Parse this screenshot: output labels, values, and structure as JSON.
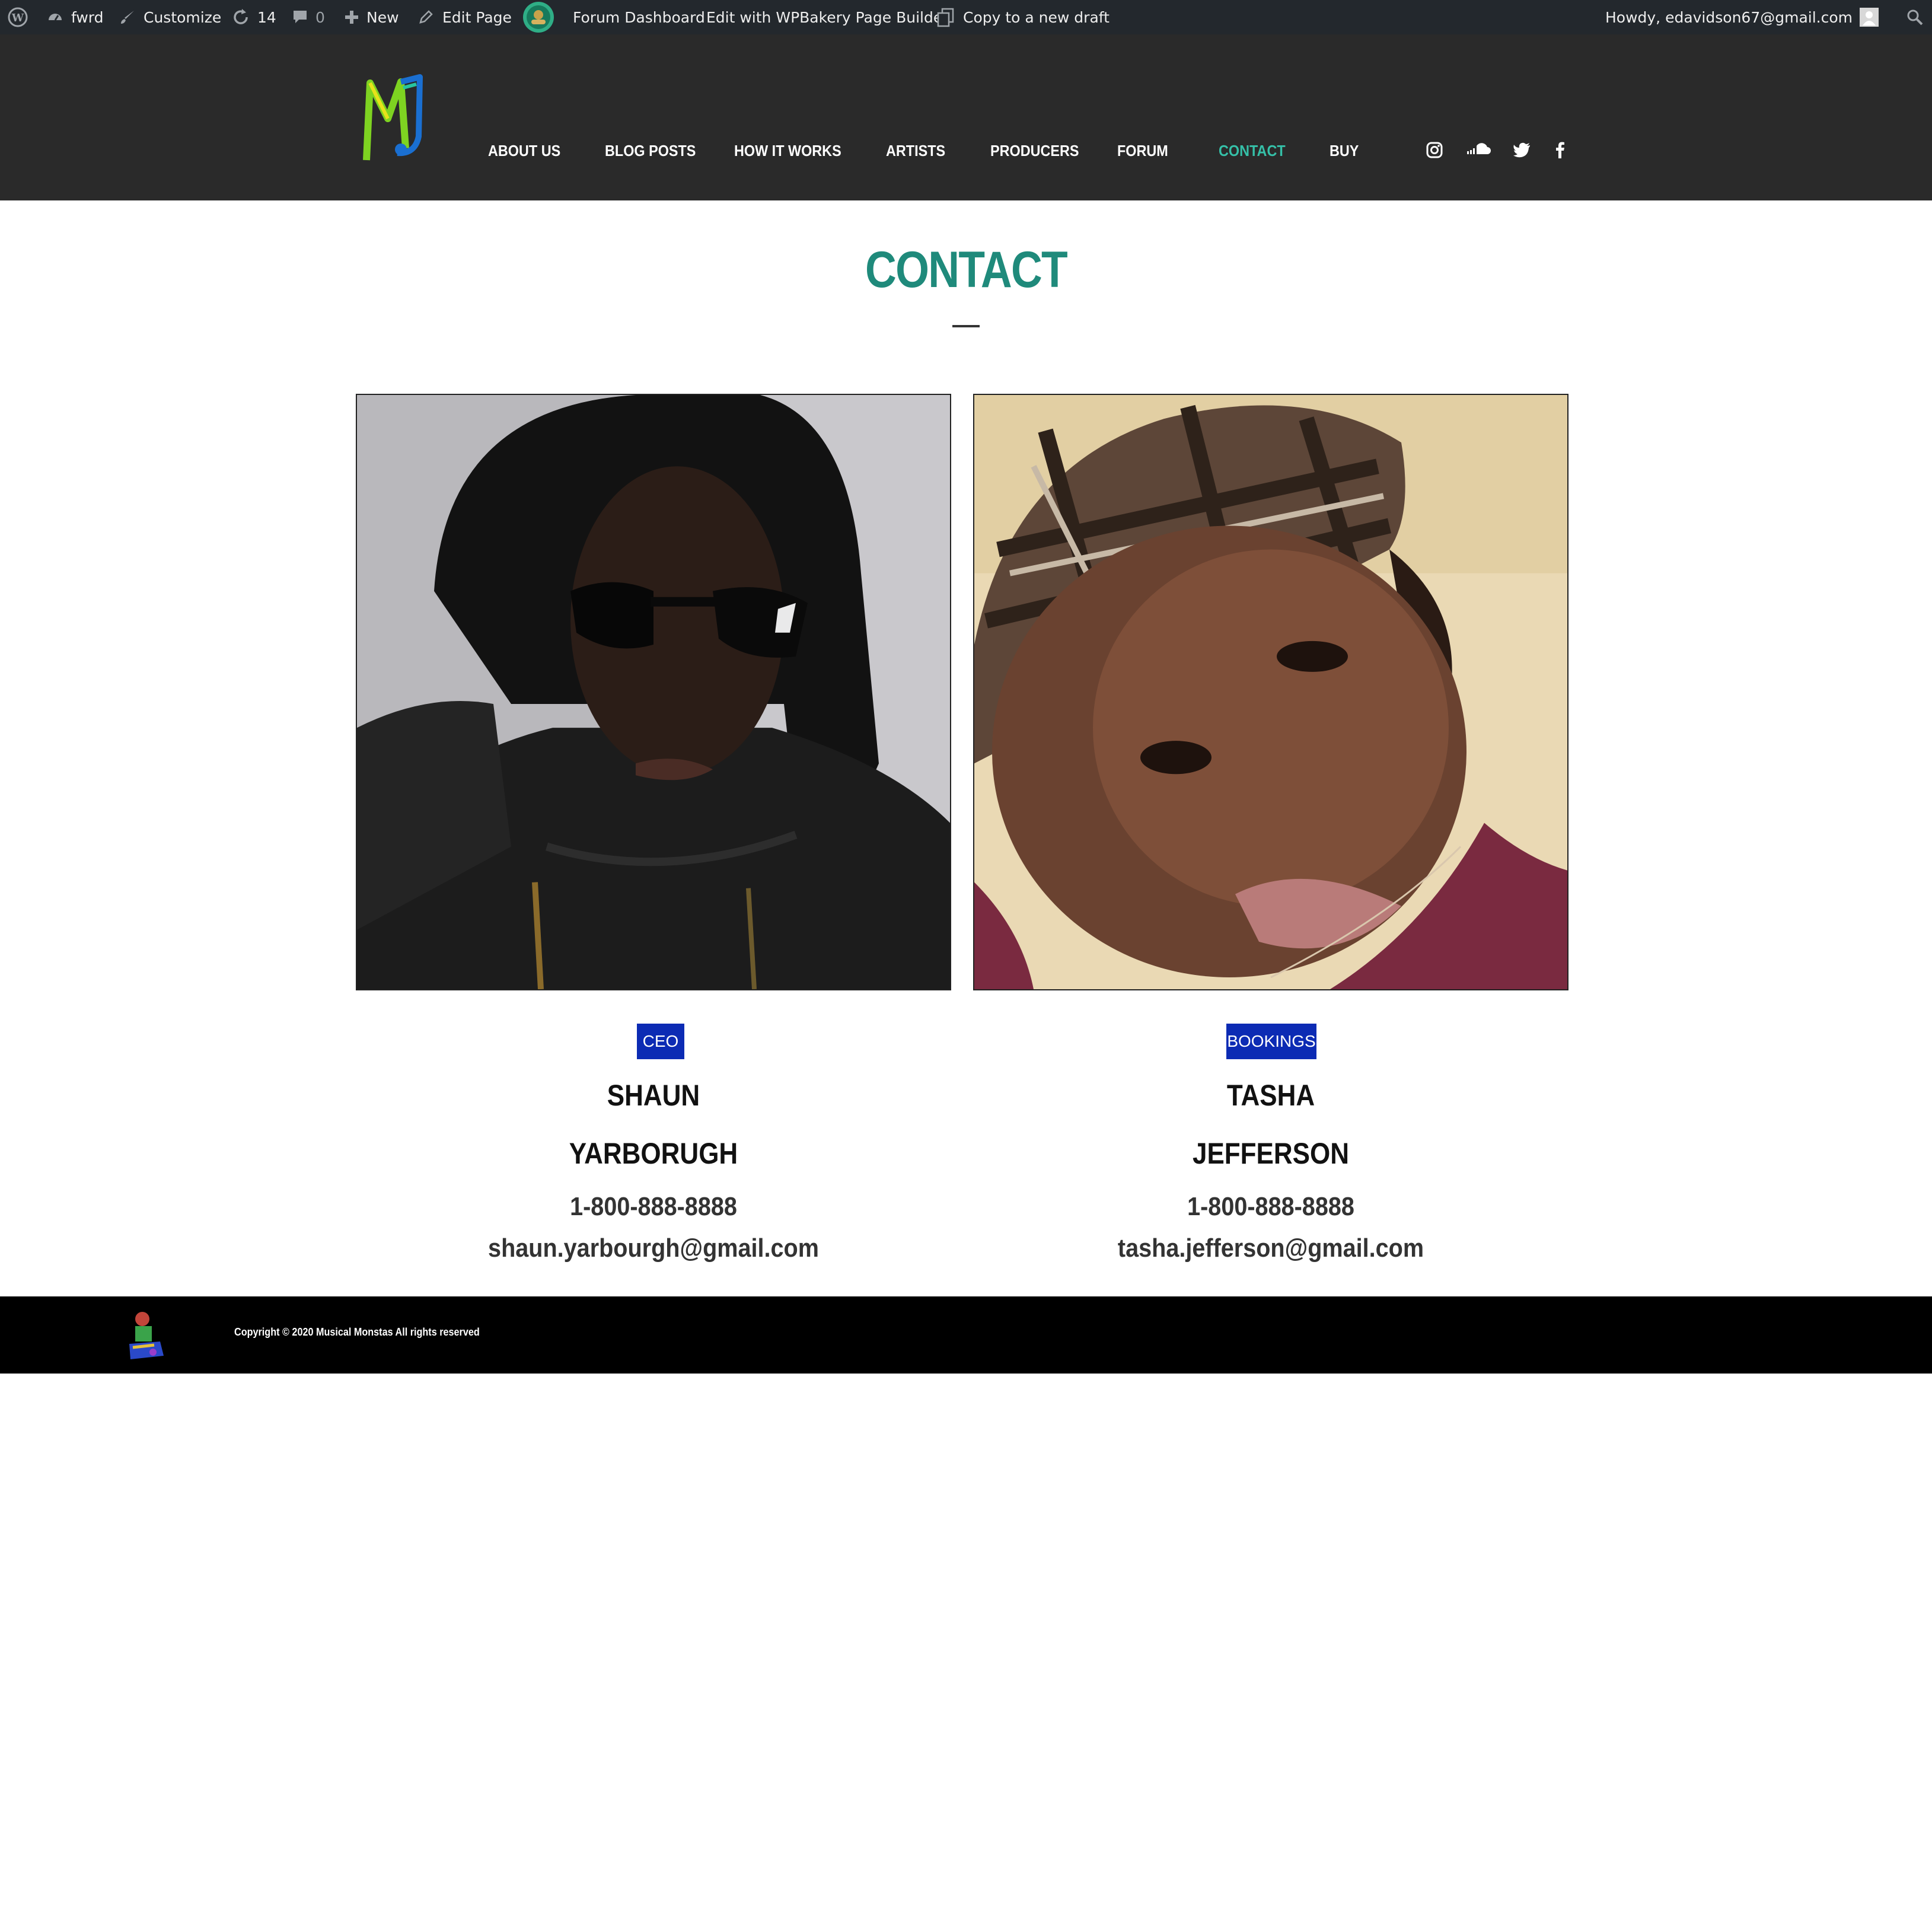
{
  "admin_bar": {
    "site_name": "fwrd",
    "customize": "Customize",
    "updates_count": "14",
    "comments_count": "0",
    "new": "New",
    "edit_page": "Edit Page",
    "forum_dashboard": "Forum Dashboard",
    "edit_wpbakery": "Edit with WPBakery Page Builder",
    "copy_draft": "Copy to a new draft",
    "howdy": "Howdy, edavidson67@gmail.com"
  },
  "nav": {
    "items": [
      {
        "label": "ABOUT US"
      },
      {
        "label": "BLOG POSTS"
      },
      {
        "label": "HOW IT WORKS"
      },
      {
        "label": "ARTISTS"
      },
      {
        "label": "PRODUCERS"
      },
      {
        "label": "FORUM"
      },
      {
        "label": "CONTACT",
        "active": true
      },
      {
        "label": "BUY"
      }
    ],
    "social_icons": [
      "instagram-icon",
      "soundcloud-icon",
      "twitter-icon",
      "facebook-icon"
    ],
    "active_color": "#35c0a8"
  },
  "page": {
    "title": "CONTACT",
    "title_color": "#1f8a7b"
  },
  "contacts": [
    {
      "role": "CEO",
      "first_name": "SHAUN",
      "last_name": "YARBORUGH",
      "phone": "1-800-888-8888",
      "email": "shaun.yarbourgh@gmail.com"
    },
    {
      "role": "BOOKINGS",
      "first_name": "TASHA",
      "last_name": "JEFFERSON",
      "phone": "1-800-888-8888",
      "email": "tasha.jefferson@gmail.com"
    }
  ],
  "badge_color": "#0c2bb4",
  "footer": {
    "copyright": "Copyright © 2020 Musical Monstas All rights reserved"
  }
}
